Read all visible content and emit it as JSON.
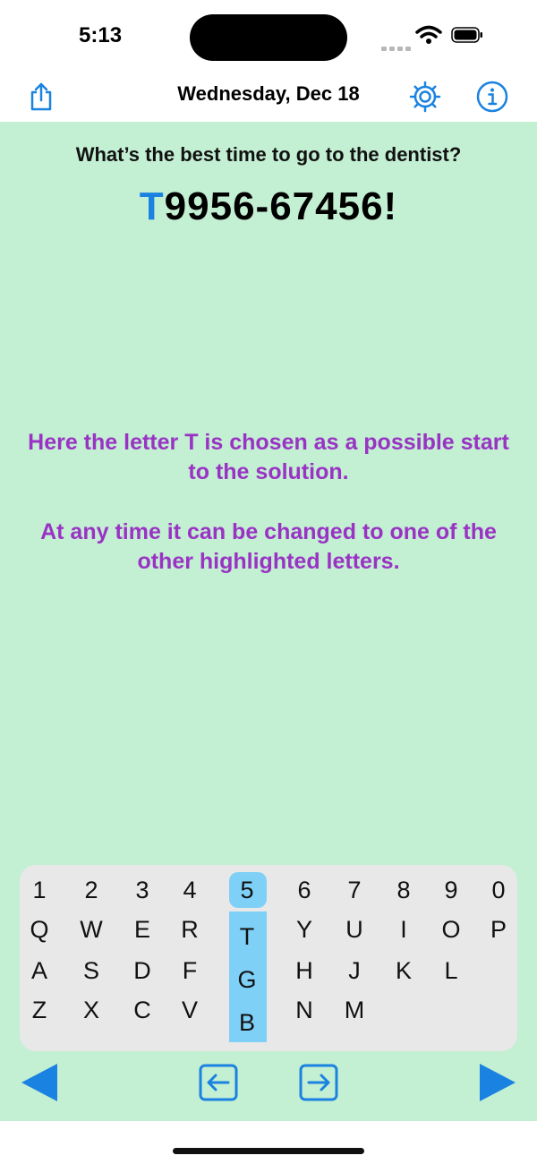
{
  "status_bar": {
    "time": "5:13"
  },
  "nav": {
    "title": "Wednesday, Dec 18",
    "share_icon": "share-icon",
    "settings_icon": "gear-icon",
    "info_icon": "info-icon"
  },
  "puzzle": {
    "question": "What’s the best time to go to the dentist?",
    "answer_first": "T",
    "answer_rest": "9956-67456!"
  },
  "hints": [
    "Here the letter T is chosen as a possible start to the solution.",
    "At any time it can be changed to one of the other highlighted letters."
  ],
  "keyboard": {
    "rows": [
      [
        "1",
        "2",
        "3",
        "4",
        "5",
        "6",
        "7",
        "8",
        "9",
        "0"
      ],
      [
        "Q",
        "W",
        "E",
        "R",
        "T",
        "Y",
        "U",
        "I",
        "O",
        "P"
      ],
      [
        "A",
        "S",
        "D",
        "F",
        "G",
        "H",
        "J",
        "K",
        "L"
      ],
      [
        "Z",
        "X",
        "C",
        "V",
        "B",
        "N",
        "M"
      ]
    ],
    "highlighted": [
      "5",
      "T",
      "G",
      "B"
    ]
  },
  "controls": {
    "prev_icon": "triangle-left-icon",
    "cursor_left_icon": "arrow-left-box-icon",
    "cursor_right_icon": "arrow-right-box-icon",
    "next_icon": "triangle-right-icon"
  },
  "colors": {
    "accent_blue": "#1a82e0",
    "content_bg": "#c3efd3",
    "hint_purple": "#9a33c4",
    "key_highlight": "#7fd0f7"
  }
}
